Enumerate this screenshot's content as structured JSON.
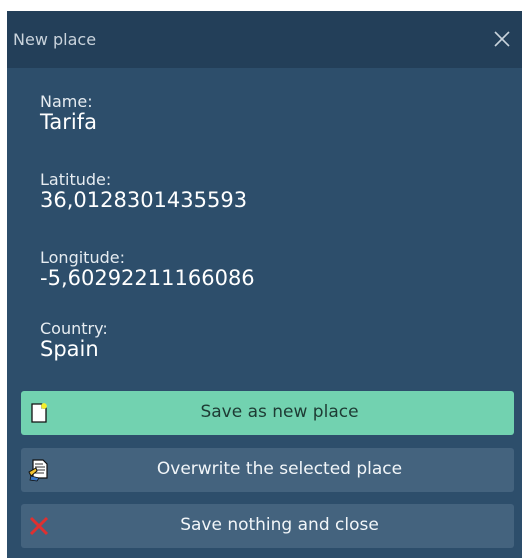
{
  "window": {
    "title": "New place",
    "close_icon": "close-icon"
  },
  "fields": {
    "name": {
      "label": "Name:",
      "value": "Tarifa"
    },
    "latitude": {
      "label": "Latitude:",
      "value": "36,0128301435593"
    },
    "longitude": {
      "label": "Longitude:",
      "value": "-5,60292211166086"
    },
    "country": {
      "label": "Country:",
      "value": "Spain"
    }
  },
  "buttons": {
    "save_new": {
      "label": "Save as new place",
      "icon": "new-document-icon"
    },
    "overwrite": {
      "label": "Overwrite the selected place",
      "icon": "overwrite-document-icon"
    },
    "close": {
      "label": "Save nothing and close",
      "icon": "red-x-icon"
    }
  },
  "colors": {
    "dialog_background": "#2d4e6b",
    "titlebar_background": "#233f59",
    "primary_button": "#72d2b0",
    "secondary_button": "#44637e",
    "close_x": "#e03030"
  }
}
